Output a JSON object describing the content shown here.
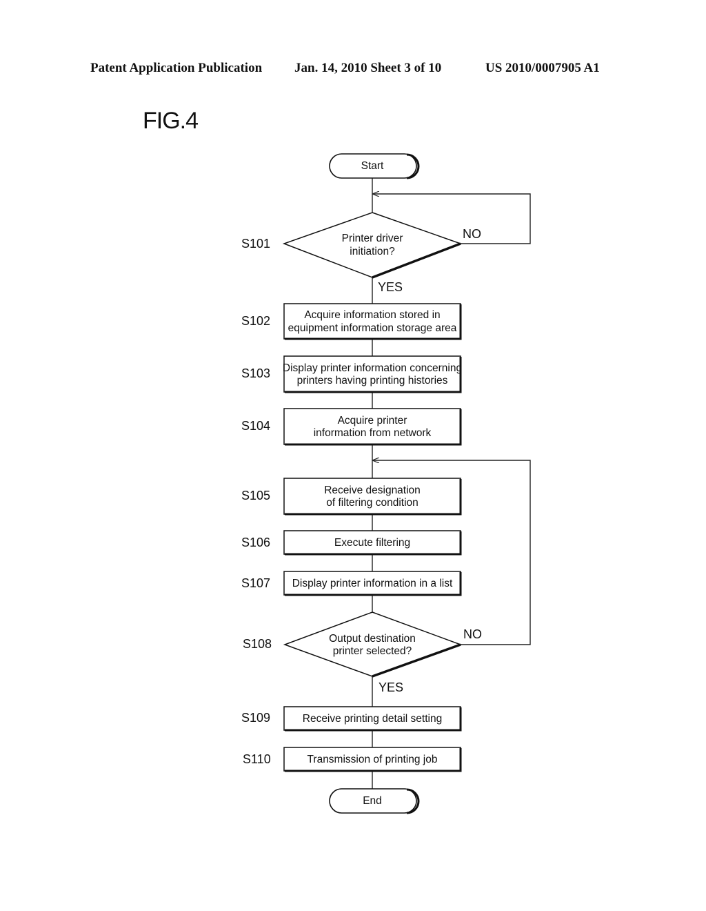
{
  "header": {
    "publication": "Patent Application Publication",
    "date_sheet": "Jan. 14, 2010  Sheet 3 of 10",
    "number": "US 2010/0007905 A1"
  },
  "figure": {
    "title": "FIG.4"
  },
  "flowchart": {
    "start": "Start",
    "end": "End",
    "steps": [
      {
        "id": "S101",
        "type": "decision",
        "lines": [
          "Printer driver",
          "initiation?"
        ],
        "yes": "YES",
        "no": "NO"
      },
      {
        "id": "S102",
        "type": "process",
        "lines": [
          "Acquire information stored in",
          "equipment information storage area"
        ]
      },
      {
        "id": "S103",
        "type": "process",
        "lines": [
          "Display printer information concerning",
          "printers having printing histories"
        ]
      },
      {
        "id": "S104",
        "type": "process",
        "lines": [
          "Acquire printer",
          "information from network"
        ]
      },
      {
        "id": "S105",
        "type": "process",
        "lines": [
          "Receive designation",
          "of filtering condition"
        ]
      },
      {
        "id": "S106",
        "type": "process",
        "lines": [
          "Execute filtering"
        ]
      },
      {
        "id": "S107",
        "type": "process",
        "lines": [
          "Display printer information in a list"
        ]
      },
      {
        "id": "S108",
        "type": "decision",
        "lines": [
          "Output destination",
          "printer selected?"
        ],
        "yes": "YES",
        "no": "NO"
      },
      {
        "id": "S109",
        "type": "process",
        "lines": [
          "Receive printing detail setting"
        ]
      },
      {
        "id": "S110",
        "type": "process",
        "lines": [
          "Transmission of printing job"
        ]
      }
    ]
  }
}
